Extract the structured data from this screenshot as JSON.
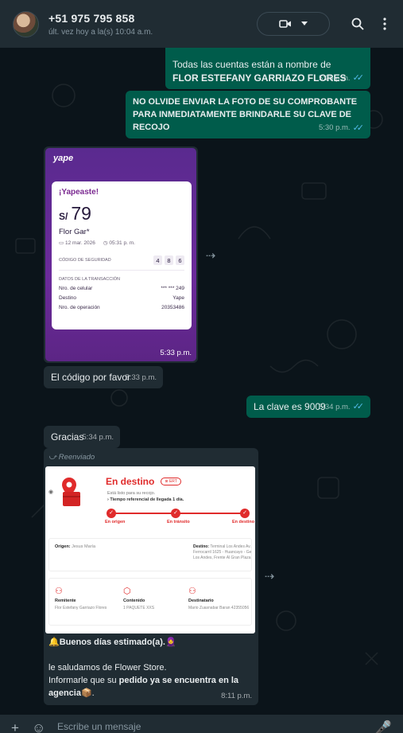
{
  "header": {
    "contact_name": "+51 975 795 858",
    "last_seen": "últ. vez hoy a la(s) 10:04 a.m."
  },
  "messages": {
    "m1_line1": "Todas las cuentas están a nombre de",
    "m1_line2": "FLOR ESTEFANY GARRIAZO FLORES",
    "m1_time": "5:28 p.m.",
    "m2_line1": "NO OLVIDE ENVIAR LA FOTO DE SU COMPROBANTE",
    "m2_line2": "PARA INMEDIATAMENTE BRINDARLE SU CLAVE DE",
    "m2_line3": "RECOJO",
    "m2_time": "5:30 p.m.",
    "m3_time": "5:33 p.m.",
    "m4_text": "El código por favor",
    "m4_time": "5:33 p.m.",
    "m5_text": "La clave es 9009",
    "m5_time": "5:34 p.m.",
    "m6_text": "Gracias",
    "m6_time": "5:34 p.m.",
    "m7_forwarded": "Reenviado",
    "m7_line1": "Buenos días estimado(a).",
    "m7_line2": "le saludamos de Flower Store.",
    "m7_line3a": "Informarle que su ",
    "m7_line3b": "pedido ya se encuentra en la",
    "m7_line4": "agencia",
    "m7_time": "8:11 p.m."
  },
  "yape": {
    "logo": "yape",
    "heading": "¡Yapeaste!",
    "currency": "S/",
    "amount": "79",
    "recipient": "Flor Gar*",
    "date": "12 mar. 2026",
    "time": "05:31 p. m.",
    "security_label": "CÓDIGO DE SEGURIDAD",
    "security_digits": [
      "4",
      "8",
      "6"
    ],
    "details_label": "DATOS DE LA TRANSACCIÓN",
    "rows": [
      {
        "label": "Nro. de celular",
        "value": "*** *** 249"
      },
      {
        "label": "Destino",
        "value": "Yape"
      },
      {
        "label": "Nro. de operación",
        "value": "20353486"
      }
    ]
  },
  "shipping": {
    "status": "En destino",
    "badge": "ERT",
    "sub1": "Está listo para su recojo.",
    "sub2": "Tiempo referencial de llegada 1 día.",
    "steps": [
      "En origen",
      "En tránsito",
      "En destino"
    ],
    "origin_label": "Origen:",
    "origin_value": "Jesus María",
    "dest_label": "Destino:",
    "dest_value": "Terminal Los Andes Av. Ferrocarril 1625 - Huancayo - Ge Los Andes, Frente Al Gran Plaza",
    "sender_label": "Remitente",
    "sender_value": "Flor Estefany Garriazo Flores",
    "content_label": "Contenido",
    "content_value": "1 PAQUETE XXS",
    "addressee_label": "Destinatario",
    "addressee_value": "Mario Zuasnabar Baran 42355056"
  },
  "composer": {
    "placeholder": "Escribe un mensaje"
  },
  "colors": {
    "outgoing": "#005c4b",
    "incoming": "#202c33",
    "background": "#0b141a",
    "ticks": "#53bdeb",
    "yape_purple": "#6b2a9a",
    "shipping_red": "#e02b2b"
  }
}
